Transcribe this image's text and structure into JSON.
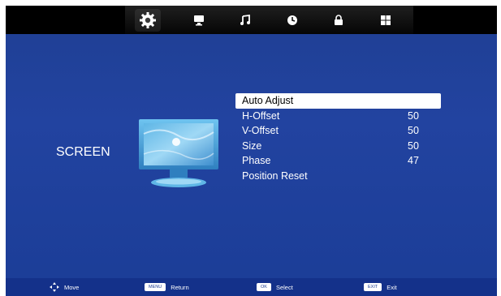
{
  "tabs": [
    {
      "name": "picture-settings-icon",
      "active": true
    },
    {
      "name": "monitor-icon",
      "active": false
    },
    {
      "name": "music-note-icon",
      "active": false
    },
    {
      "name": "clock-icon",
      "active": false
    },
    {
      "name": "lock-icon",
      "active": false
    },
    {
      "name": "grid-icon",
      "active": false
    }
  ],
  "page_title": "SCREEN",
  "menu": {
    "items": [
      {
        "label": "Auto Adjust",
        "value": "",
        "selected": true
      },
      {
        "label": "H-Offset",
        "value": "50",
        "selected": false
      },
      {
        "label": "V-Offset",
        "value": "50",
        "selected": false
      },
      {
        "label": "Size",
        "value": "50",
        "selected": false
      },
      {
        "label": "Phase",
        "value": "47",
        "selected": false
      },
      {
        "label": "Position Reset",
        "value": "",
        "selected": false
      }
    ]
  },
  "footer": {
    "move": {
      "label": "Move"
    },
    "menu": {
      "key": "MENU",
      "label": "Return"
    },
    "ok": {
      "key": "OK",
      "label": "Select"
    },
    "exit": {
      "key": "EXIT",
      "label": "Exit"
    }
  },
  "colors": {
    "background": "#1f3f93",
    "selection": "#ffffff",
    "text": "#ffffff"
  }
}
